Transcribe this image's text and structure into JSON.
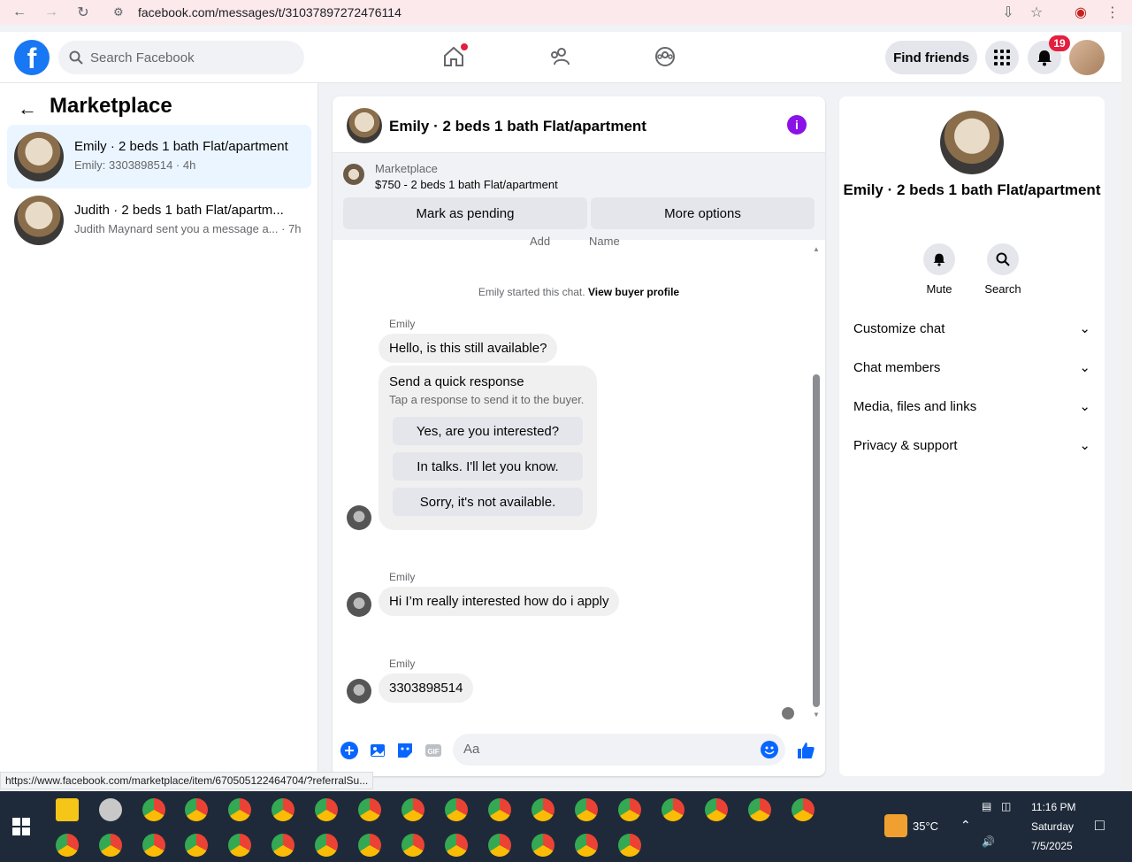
{
  "browser": {
    "url": "facebook.com/messages/t/31037897272476114"
  },
  "header": {
    "logo": "f",
    "search_placeholder": "Search Facebook",
    "find_friends": "Find friends",
    "notif_count": "19"
  },
  "left": {
    "title": "Marketplace",
    "conversations": [
      {
        "title": "Emily · 2 beds 1 bath Flat/apartment",
        "sub": "Emily: 3303898514 · 4h"
      },
      {
        "title": "Judith · 2 beds 1 bath Flat/apartm...",
        "sub": "Judith Maynard sent you a message a... · 7h"
      }
    ]
  },
  "chat": {
    "title": "Emily · 2 beds 1 bath Flat/apartment",
    "marketplace_label": "Marketplace",
    "listing": "$750 - 2 beds 1 bath Flat/apartment",
    "btn_pending": "Mark as pending",
    "btn_more": "More options",
    "cut_add": "Add",
    "cut_name": "Name",
    "started_text": "Emily started this chat.",
    "view_profile": "View buyer profile",
    "sender": "Emily",
    "msg1": "Hello, is this still available?",
    "quick_title": "Send a quick response",
    "quick_sub": "Tap a response to send it to the buyer.",
    "quick_opts": [
      "Yes, are you interested?",
      "In talks. I'll let you know.",
      "Sorry, it's not available."
    ],
    "msg2": "Hi I’m really interested how do i apply",
    "msg3": "3303898514",
    "composer_placeholder": "Aa"
  },
  "right": {
    "title": "Emily · 2 beds 1 bath Flat/apartment",
    "mute": "Mute",
    "search": "Search",
    "rows": [
      "Customize chat",
      "Chat members",
      "Media, files and links",
      "Privacy & support"
    ]
  },
  "status_url": "https://www.facebook.com/marketplace/item/670505122464704/?referralSu...",
  "taskbar": {
    "temp": "35°C",
    "time": "11:16 PM",
    "day": "Saturday",
    "date": "7/5/2025"
  },
  "colors": {
    "fb_blue": "#1877f2",
    "messenger_blue": "#0866ff",
    "purple": "#8a12e6",
    "badge_red": "#e41e3f"
  }
}
